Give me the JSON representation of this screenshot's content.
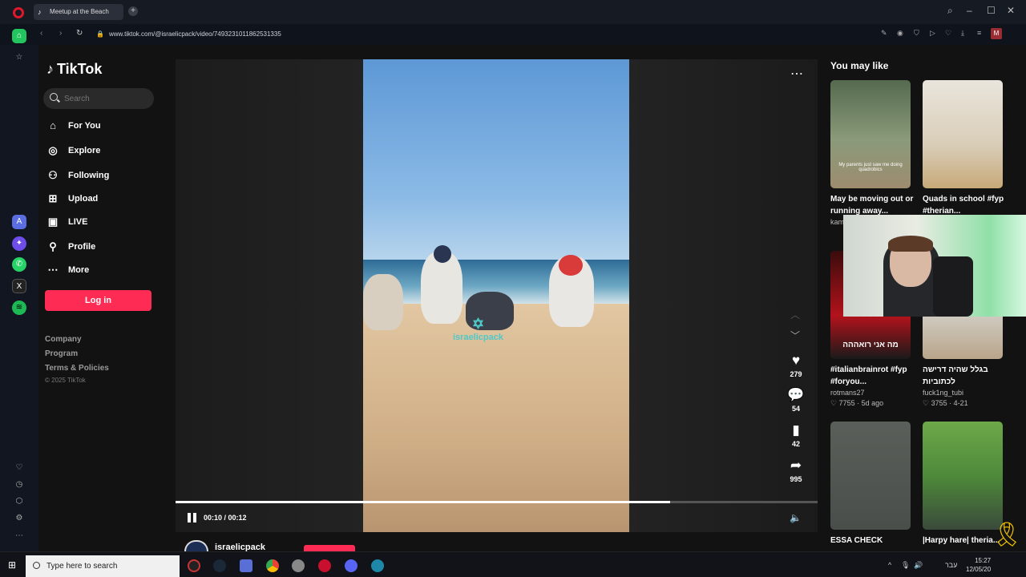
{
  "browser": {
    "tab_title": "Meetup at the Beach",
    "url": "www.tiktok.com/@israelicpack/video/7493231011862531335",
    "profile_initial": "M"
  },
  "tiktok": {
    "logo": "TikTok",
    "search_placeholder": "Search",
    "nav": [
      {
        "label": "For You",
        "icon": "home-icon"
      },
      {
        "label": "Explore",
        "icon": "compass-icon"
      },
      {
        "label": "Following",
        "icon": "following-icon"
      },
      {
        "label": "Upload",
        "icon": "upload-icon"
      },
      {
        "label": "LIVE",
        "icon": "live-icon"
      },
      {
        "label": "Profile",
        "icon": "profile-icon"
      },
      {
        "label": "More",
        "icon": "more-icon"
      }
    ],
    "login": "Log in",
    "footer": [
      "Company",
      "Program",
      "Terms & Policies"
    ],
    "copyright": "© 2025 TikTok",
    "accent": "#fe2c55"
  },
  "video": {
    "watermark": "israelicpack",
    "likes": "279",
    "comments": "54",
    "saves": "42",
    "shares": "995",
    "time": "00:10 / 00:12",
    "progress": 0.77,
    "author": "israelicpack"
  },
  "you_may_like": {
    "title": "You may like",
    "cards": [
      {
        "title": "May be moving out or running away...",
        "user": "kam",
        "thumb_text": "My parents just saw me doing quadrobics"
      },
      {
        "title": "Quads in school #fyp #therian...",
        "user": "",
        "thumb_text": ""
      },
      {
        "title": "#italianbrainrot #fyp #foryou...",
        "user": "rotmans27",
        "meta": "7755 · 5d ago",
        "thumb_text": "מה אני רואההה"
      },
      {
        "title": "בגלל שהיה דרישה לכתוביות",
        "user": "fuck1ng_tubi",
        "meta": "3755 · 4-21",
        "thumb_text": ""
      },
      {
        "title": "ESSA CHECK",
        "user": "",
        "thumb_text": ""
      },
      {
        "title": "|Harpy hare| theria...",
        "user": "",
        "thumb_text": ""
      }
    ]
  },
  "taskbar": {
    "search_placeholder": "Type here to search",
    "lang": "עבר",
    "time": "15:27",
    "date": "12/05/20"
  }
}
